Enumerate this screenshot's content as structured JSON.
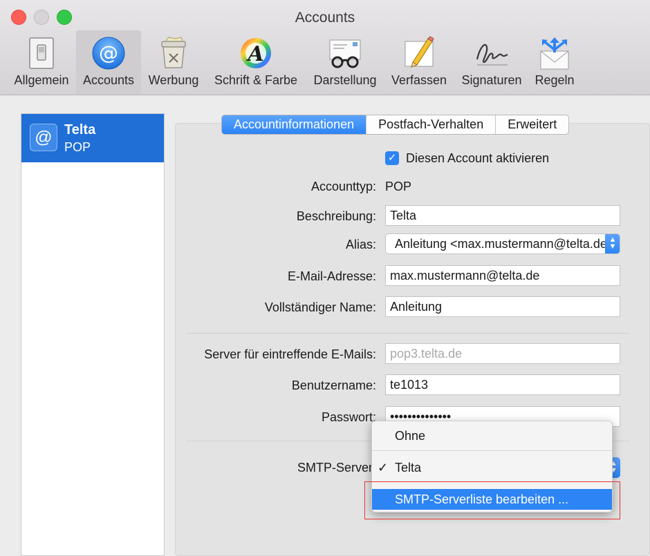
{
  "window": {
    "title": "Accounts"
  },
  "toolbar": [
    {
      "label": "Allgemein",
      "icon": "switch-icon"
    },
    {
      "label": "Accounts",
      "icon": "at-sign-icon"
    },
    {
      "label": "Werbung",
      "icon": "trash-can-icon"
    },
    {
      "label": "Schrift & Farbe",
      "icon": "font-color-icon"
    },
    {
      "label": "Darstellung",
      "icon": "glasses-icon"
    },
    {
      "label": "Verfassen",
      "icon": "pencil-icon"
    },
    {
      "label": "Signaturen",
      "icon": "signature-icon"
    },
    {
      "label": "Regeln",
      "icon": "rules-envelope-icon"
    }
  ],
  "sidebar": {
    "account": {
      "name": "Telta",
      "type": "POP",
      "icon_glyph": "@"
    }
  },
  "tabs": [
    "Accountinformationen",
    "Postfach-Verhalten",
    "Erweitert"
  ],
  "form": {
    "enable_label": "Diesen Account aktivieren",
    "account_type_label": "Accounttyp:",
    "account_type_value": "POP",
    "description_label": "Beschreibung:",
    "description_value": "Telta",
    "alias_label": "Alias:",
    "alias_value": "Anleitung <max.mustermann@telta.de>",
    "email_label": "E-Mail-Adresse:",
    "email_value": "max.mustermann@telta.de",
    "fullname_label": "Vollständiger Name:",
    "fullname_value": "Anleitung",
    "incoming_label": "Server für eintreffende E-Mails:",
    "incoming_value": "pop3.telta.de",
    "username_label": "Benutzername:",
    "username_value": "te1013",
    "password_label": "Passwort:",
    "password_value": "••••••••••••••",
    "smtp_label": "SMTP-Server:"
  },
  "smtp_menu": {
    "items": [
      "Ohne",
      "Telta",
      "SMTP-Serverliste bearbeiten ..."
    ],
    "checkmark": "✓"
  },
  "colors": {
    "accent": "#2d84f4",
    "highlight_box": "#e2332f"
  }
}
